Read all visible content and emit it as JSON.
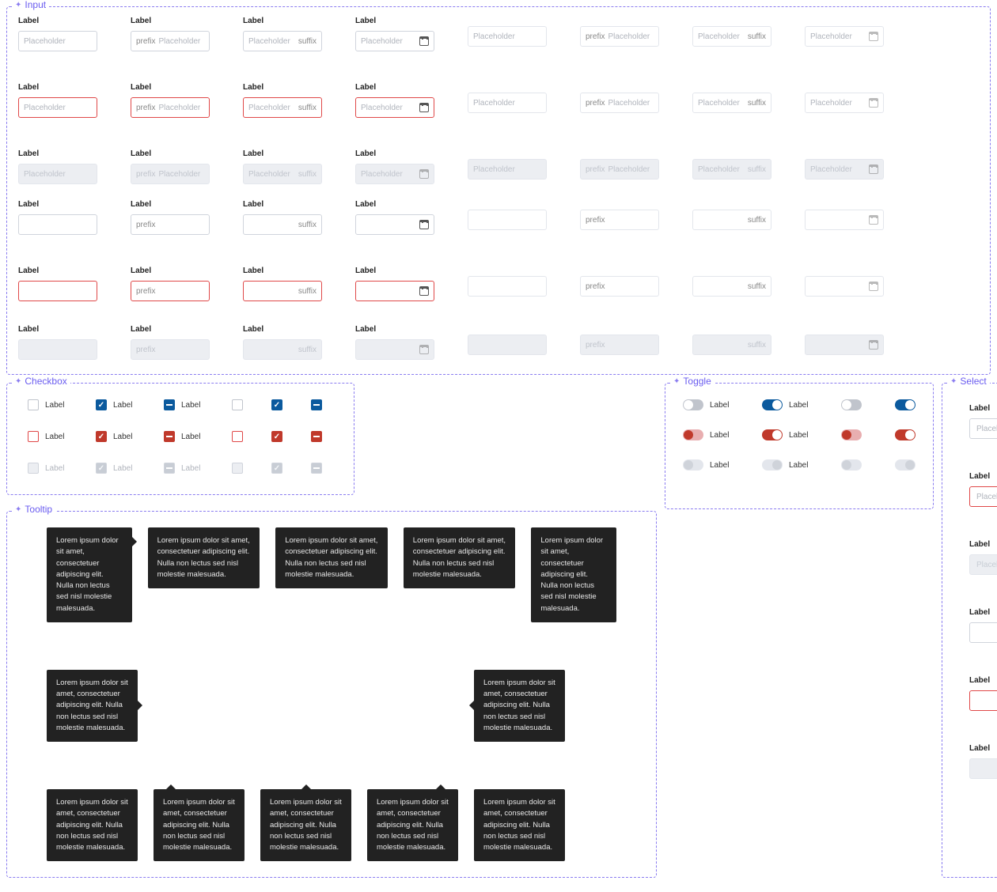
{
  "sections": {
    "input": "Input",
    "checkbox": "Checkbox",
    "toggle": "Toggle",
    "tooltip": "Tooltip",
    "select": "Select"
  },
  "label": "Label",
  "placeholder": "Placeholder",
  "prefix": "prefix",
  "suffix": "suffix",
  "tooltip_text": "Lorem ipsum dolor sit amet, consectetuer adipiscing elit. Nulla non lectus sed nisl molestie malesuada."
}
